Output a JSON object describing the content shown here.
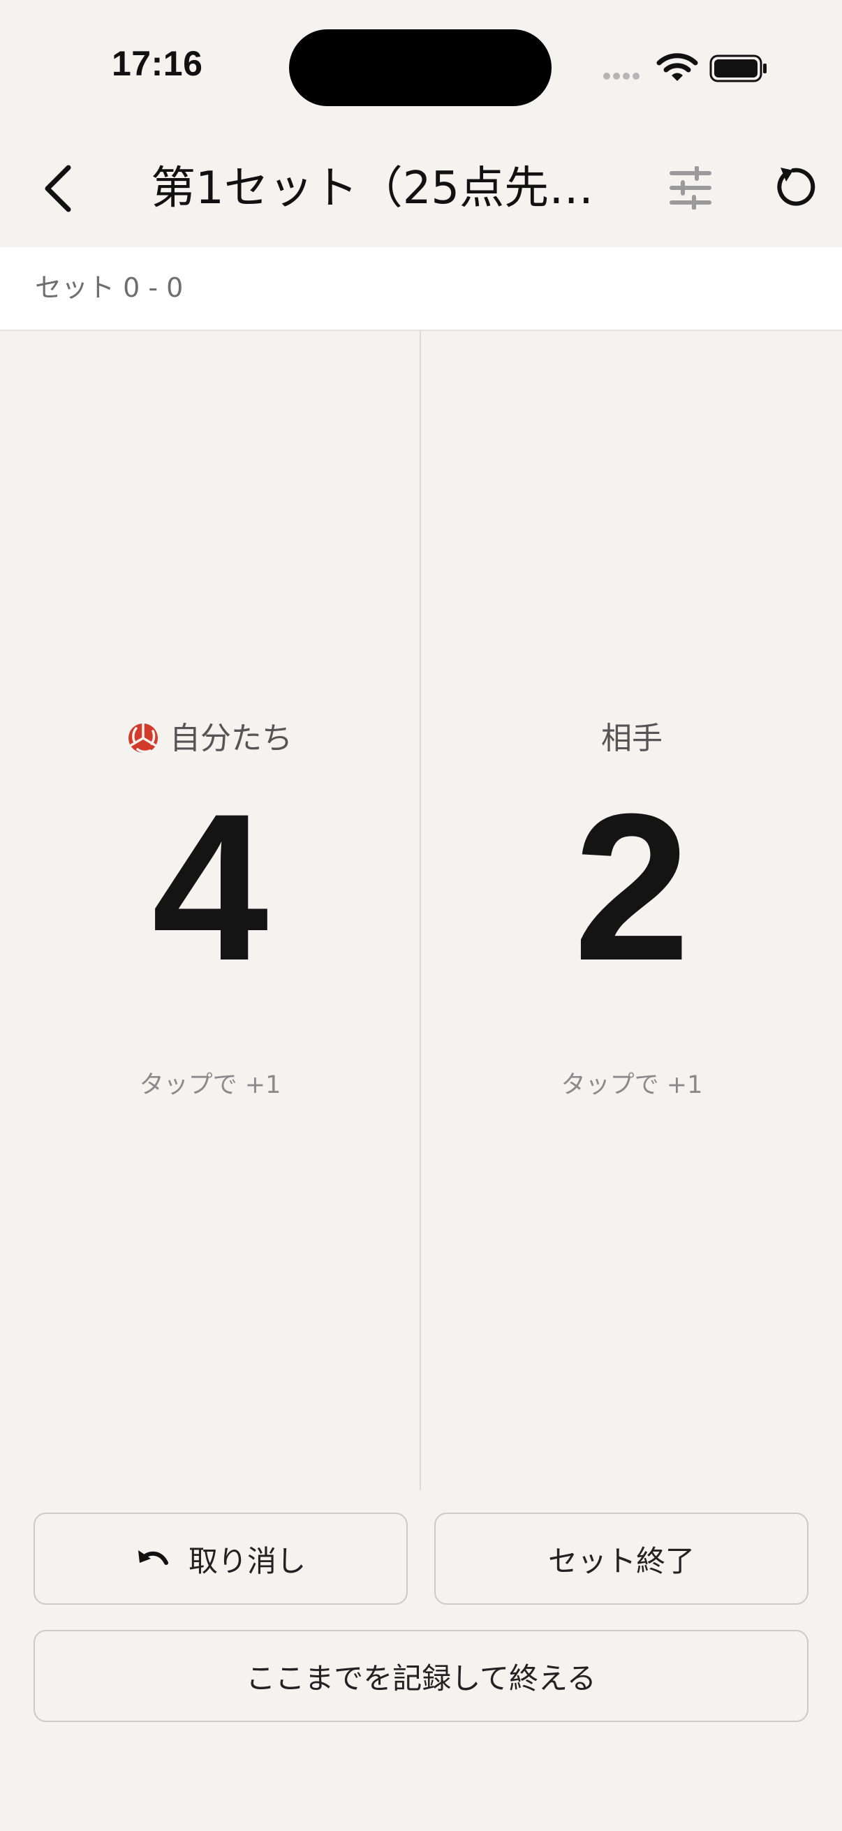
{
  "status_bar": {
    "time": "17:16"
  },
  "nav": {
    "title": "第1セット（25点先…"
  },
  "set_score": {
    "label": "セット 0 - 0"
  },
  "teams": {
    "home": {
      "name": "自分たち",
      "score": "4",
      "hint": "タップで +1"
    },
    "away": {
      "name": "相手",
      "score": "2",
      "hint": "タップで +1"
    }
  },
  "buttons": {
    "undo": "取り消し",
    "end_set": "セット終了",
    "finish": "ここまでを記録して終える"
  },
  "colors": {
    "accent": "#d23a2c",
    "background": "#f4f3f0"
  },
  "icons": [
    "back-chevron",
    "sliders",
    "reset-arrow",
    "volleyball",
    "undo-arrow"
  ]
}
